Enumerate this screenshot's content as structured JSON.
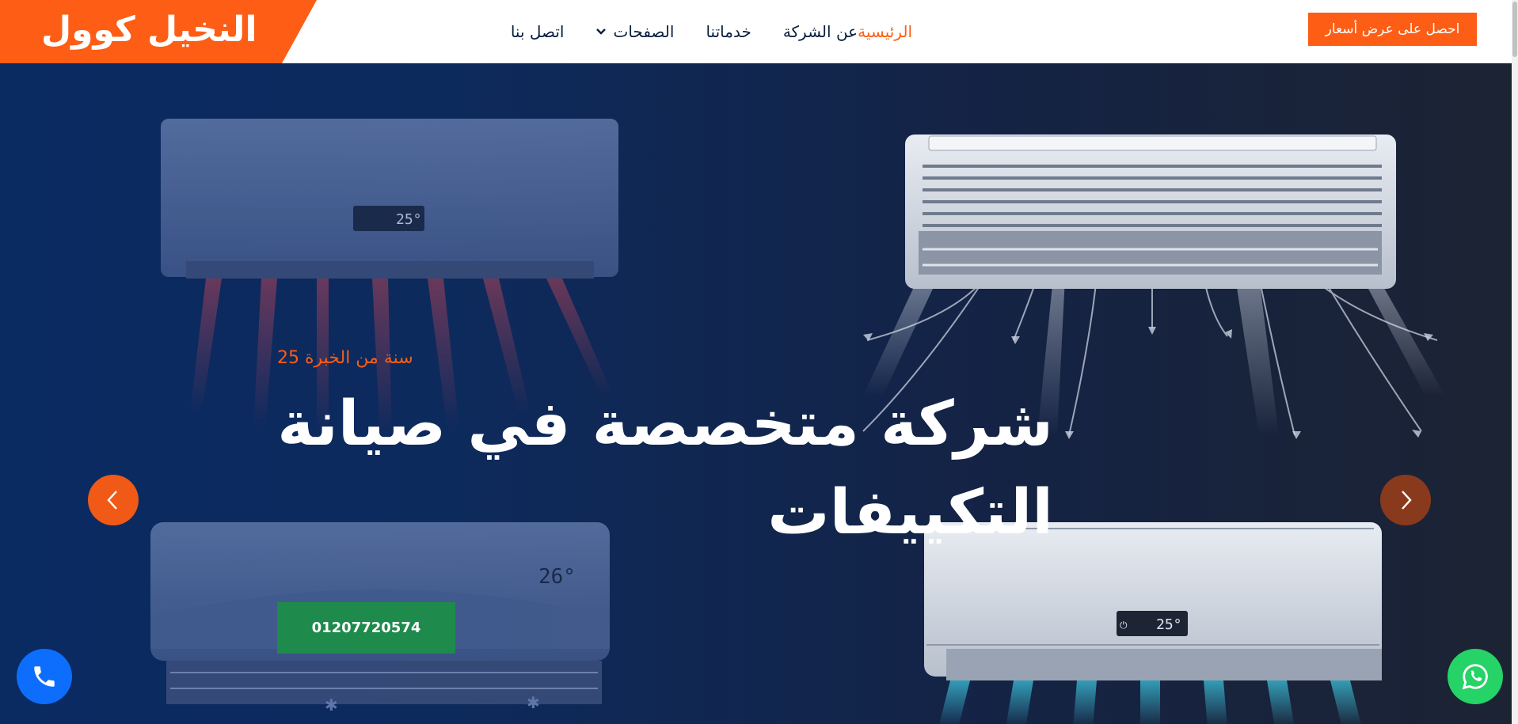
{
  "brand": {
    "name": "النخيل كوول",
    "color": "#fd5d14"
  },
  "nav": {
    "items": [
      {
        "label": "الرئيسية",
        "active": true
      },
      {
        "label": "عن الشركة",
        "active": false
      },
      {
        "label": "خدماتنا",
        "active": false
      },
      {
        "label": "الصفحات",
        "active": false,
        "dropdown": true
      },
      {
        "label": "اتصل بنا",
        "active": false
      }
    ],
    "cta_label": "احصل على عرض أسعار"
  },
  "hero": {
    "subtitle": "سنة من الخبرة 25",
    "title": "شركة متخصصة في صيانة التكييفات",
    "phone_button": "01207720574",
    "ac_displays": [
      "25",
      "26°",
      "25"
    ],
    "prev_icon": "chevron-left-icon",
    "next_icon": "chevron-right-icon"
  },
  "floating": {
    "call_icon": "phone-icon",
    "whatsapp_icon": "whatsapp-icon"
  },
  "colors": {
    "accent": "#fd5d14",
    "navy": "#091e3e",
    "green": "#1e8a4c",
    "whatsapp": "#25d366",
    "call": "#0d6efd"
  }
}
